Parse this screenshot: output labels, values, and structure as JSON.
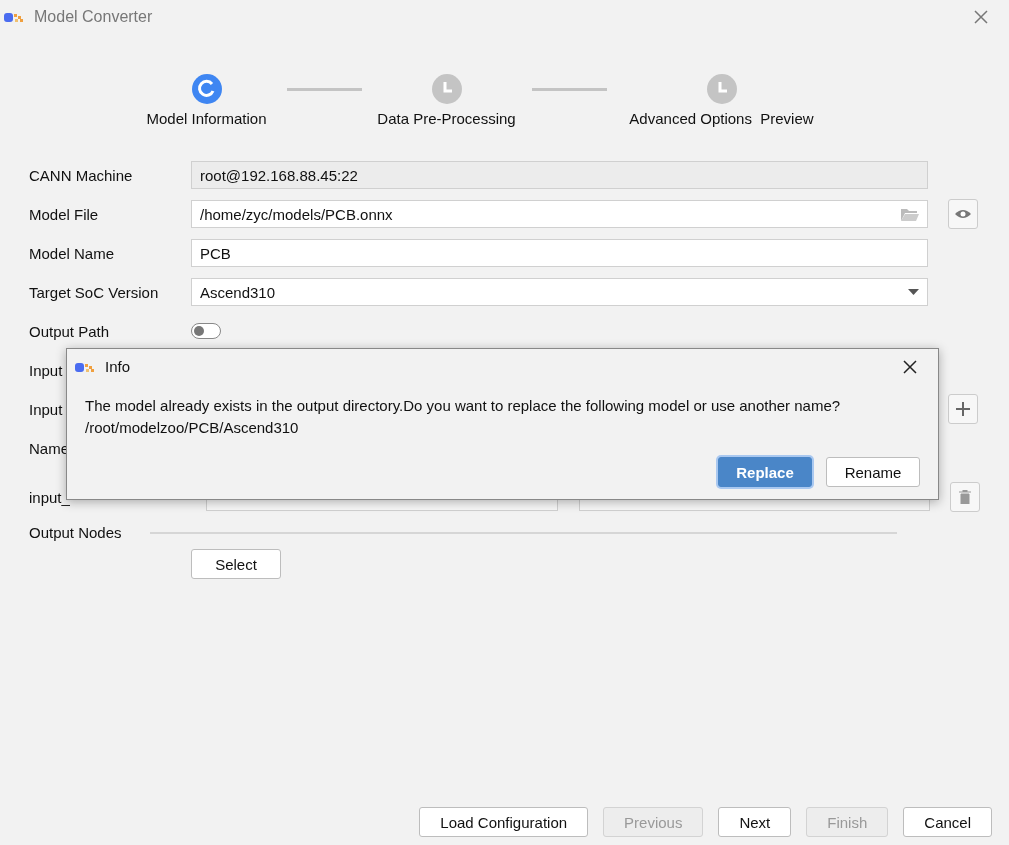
{
  "window": {
    "title": "Model Converter"
  },
  "steps": [
    {
      "label": "Model Information",
      "selected": true
    },
    {
      "label": "Data Pre-Processing",
      "selected": false
    },
    {
      "label": "Advanced Options  Preview",
      "selected": false
    }
  ],
  "form": [
    {
      "kind": "readonly",
      "label": "CANN Machine",
      "value": "root@192.168.88.45:22"
    },
    {
      "kind": "file",
      "label": "Model File",
      "value": "/home/zyc/models/PCB.onnx"
    },
    {
      "kind": "text",
      "label": "Model Name",
      "value": "PCB"
    },
    {
      "kind": "select",
      "label": "Target SoC Version",
      "value": "Ascend310"
    },
    {
      "kind": "toggle",
      "label": "Output Path",
      "on": false
    }
  ],
  "input_rows": [
    {
      "kind": "label",
      "label": "Input"
    },
    {
      "kind": "add",
      "label": "Input"
    },
    {
      "kind": "label",
      "label": "Name"
    },
    {
      "kind": "node",
      "label": "input_"
    }
  ],
  "output_nodes": {
    "label": "Output Nodes",
    "button": "Select"
  },
  "footer": [
    {
      "label": "Load Configuration",
      "disabled": false
    },
    {
      "label": "Previous",
      "disabled": true
    },
    {
      "label": "Next",
      "disabled": false
    },
    {
      "label": "Finish",
      "disabled": true
    },
    {
      "label": "Cancel",
      "disabled": false
    }
  ],
  "dialog": {
    "title": "Info",
    "message": "The model already exists in the output directory.Do you want to replace the following model or use another name?",
    "path": "/root/modelzoo/PCB/Ascend310",
    "buttons": [
      {
        "label": "Replace",
        "selected": true
      },
      {
        "label": "Rename",
        "selected": false
      }
    ]
  }
}
